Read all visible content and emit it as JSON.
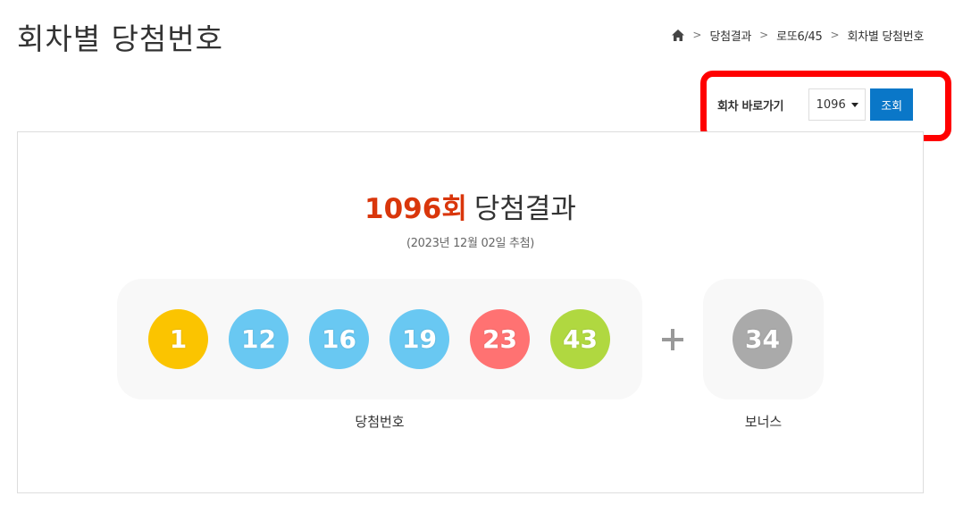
{
  "page": {
    "title": "회차별 당첨번호"
  },
  "breadcrumb": {
    "items": [
      "당첨결과",
      "로또6/45",
      "회차별 당첨번호"
    ],
    "separator": ">"
  },
  "draw_selector": {
    "label": "회차 바로가기",
    "selected": "1096",
    "button_label": "조회",
    "highlight_color": "#ff0000",
    "button_color": "#0a77c8"
  },
  "result": {
    "draw_number": "1096회",
    "heading": "당첨결과",
    "date": "(2023년 12월 02일 추첨)",
    "winning_label": "당첨번호",
    "bonus_label": "보너스",
    "plus": "+",
    "winning_numbers": [
      {
        "value": "1",
        "color": "#fbc400"
      },
      {
        "value": "12",
        "color": "#69c8f2"
      },
      {
        "value": "16",
        "color": "#69c8f2"
      },
      {
        "value": "19",
        "color": "#69c8f2"
      },
      {
        "value": "23",
        "color": "#ff7272"
      },
      {
        "value": "43",
        "color": "#b0d840"
      }
    ],
    "bonus_number": {
      "value": "34",
      "color": "#aaaaaa"
    }
  }
}
